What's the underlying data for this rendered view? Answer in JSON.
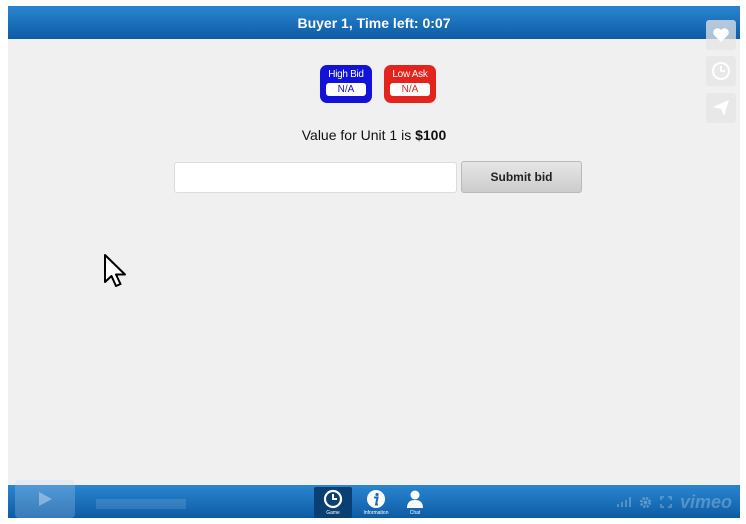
{
  "header": {
    "title": "Buyer 1, Time left: 0:07"
  },
  "badges": {
    "high_bid": {
      "label": "High Bid",
      "value": "N/A",
      "color": "#1212d8"
    },
    "low_ask": {
      "label": "Low Ask",
      "value": "N/A",
      "color": "#e4231c"
    }
  },
  "info": {
    "value_prefix": "Value for Unit 1 is ",
    "value_amount": "$100"
  },
  "bid": {
    "input_value": "",
    "submit_label": "Submit bid"
  },
  "nav": {
    "items": [
      {
        "label": "Game",
        "icon": "clock-icon",
        "active": true
      },
      {
        "label": "Information",
        "icon": "info-icon",
        "active": false
      },
      {
        "label": "Chat",
        "icon": "user-icon",
        "active": false
      }
    ]
  },
  "player": {
    "brand": "vimeo"
  },
  "colors": {
    "bar": "#1a6fbd",
    "background": "#f0f0f0"
  }
}
